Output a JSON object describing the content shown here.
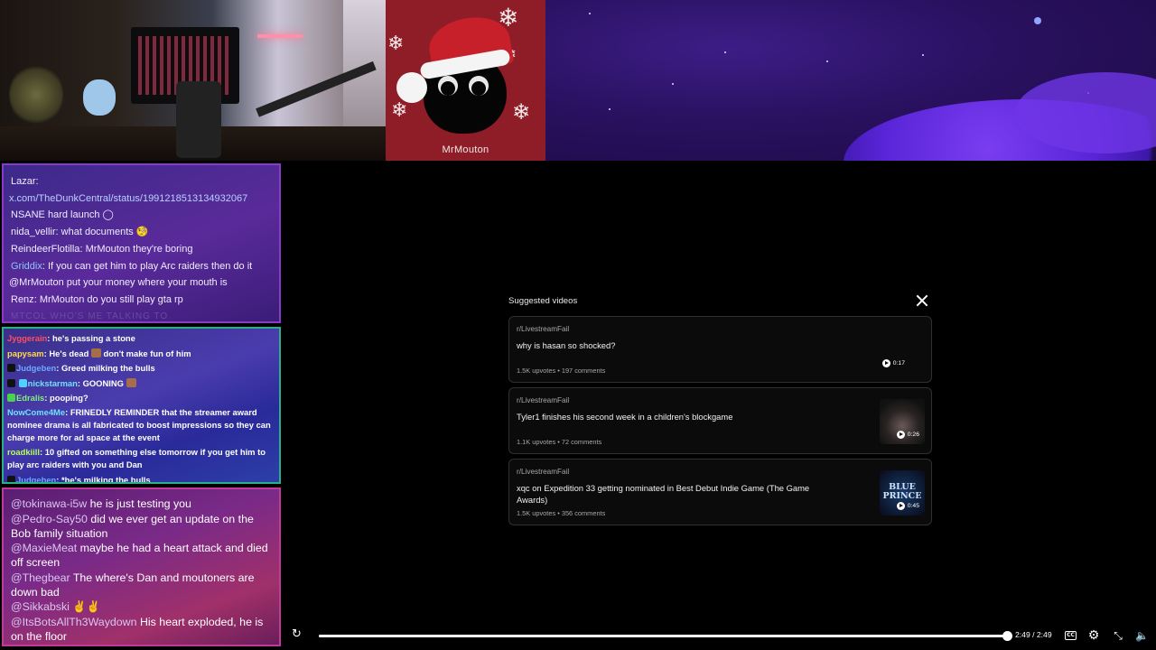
{
  "stream": {
    "overlay_name": "MrMouton"
  },
  "chat_primary": {
    "lines": [
      {
        "user": "Lazar",
        "sep": ":",
        "text": ""
      },
      {
        "user": "",
        "sep": "",
        "text": "x.com/TheDunkCentral/status/1991218513134932067"
      },
      {
        "user": "",
        "sep": "",
        "text": "NSANE hard launch ◯"
      },
      {
        "user": "nida_vellir",
        "sep": ": ",
        "text": "what documents"
      },
      {
        "user": "ReindeerFlotilla",
        "sep": ": ",
        "text": "MrMouton they're boring"
      },
      {
        "user": "Griddix",
        "sep": ": ",
        "text": "If you can get him to play Arc raiders then do it"
      },
      {
        "user": "",
        "sep": "",
        "text": "@MrMouton put your money where your mouth is"
      },
      {
        "user": "Renz",
        "sep": ": ",
        "text": "MrMouton do you still play gta rp"
      },
      {
        "user": "",
        "sep": "",
        "text": "MTCOL WHO'S ME TALKING TO"
      }
    ]
  },
  "chat_secondary": {
    "lines": [
      {
        "user": "Jyggerain",
        "color": "red",
        "text": "he's passing a stone"
      },
      {
        "user": "papysam",
        "color": "yellow",
        "text": "He's dead",
        "text2": "don't make fun of him"
      },
      {
        "user": "Judgeben",
        "color": "blue",
        "text": "Greed milking the bulls"
      },
      {
        "user": "nickstarman",
        "color": "cyan",
        "text": "GOONING"
      },
      {
        "user": "Edralis",
        "color": "green",
        "text": "pooping?"
      },
      {
        "user": "NowCome4Me",
        "color": "cyan",
        "text": "FRINEDLY REMINDER that the streamer award nominee drama is all fabricated to boost impressions so they can charge more for ad space at the event"
      },
      {
        "user": "roadkiill",
        "color": "lime",
        "text": "10 gifted on something else tomorrow if you get him to play arc raiders with you and Dan"
      },
      {
        "user": "Judgeben",
        "color": "blue",
        "text": "*he's milking the bulls"
      }
    ]
  },
  "chat_tertiary": {
    "lines": [
      {
        "user": "@tokinawa-i5w",
        "text": "he is just testing you"
      },
      {
        "user": "@Pedro-Say50",
        "text": "did we ever get an update on the Bob family situation"
      },
      {
        "user": "@MaxieMeat",
        "text": "maybe he had a heart attack and died off screen"
      },
      {
        "user": "@Thegbear",
        "text": "The where's Dan and moutoners are down bad"
      },
      {
        "user": "@Sikkabski",
        "text": "✌✌"
      },
      {
        "user": "@ItsBotsAllTh3Waydown",
        "text": "His heart exploded, he is on the floor"
      }
    ]
  },
  "suggested": {
    "title": "Suggested videos",
    "items": [
      {
        "subreddit": "r/LivestreamFail",
        "title": "why is hasan so shocked?",
        "meta": "1.5K upvotes • 197 comments",
        "duration": "0:17",
        "thumb_text": ""
      },
      {
        "subreddit": "r/LivestreamFail",
        "title": "Tyler1 finishes his second week in a children's blockgame",
        "meta": "1.1K upvotes • 72 comments",
        "duration": "0:26",
        "thumb_text": ""
      },
      {
        "subreddit": "r/LivestreamFail",
        "title": "xqc on Expedition 33 getting nominated in Best Debut Indie Game (The Game Awards)",
        "meta": "1.5K upvotes • 356 comments",
        "duration": "0:45",
        "thumb_text": "BLUE PRINCE"
      }
    ]
  },
  "player": {
    "time": "2:49 / 2:49",
    "progress": 1.0,
    "cc_label": "CC"
  }
}
